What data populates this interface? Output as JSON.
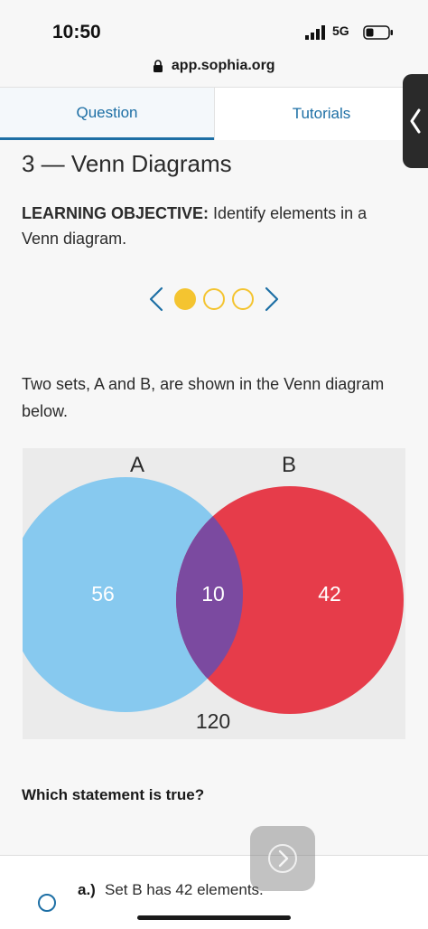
{
  "status_bar": {
    "time": "10:50",
    "network": "5G"
  },
  "browser": {
    "url": "app.sophia.org"
  },
  "tabs": [
    {
      "label": "Question",
      "active": true
    },
    {
      "label": "Tutorials",
      "active": false
    }
  ],
  "page": {
    "title": "3 — Venn Diagrams",
    "objective_label": "LEARNING OBJECTIVE:",
    "objective_text": " Identify elements in a Venn diagram."
  },
  "carousel": {
    "current": 1,
    "total": 3,
    "accent_color": "#f4c430"
  },
  "problem": {
    "prompt": "Two sets, A and B, are shown in the Venn diagram below.",
    "question": "Which statement is true?"
  },
  "venn": {
    "set_a_label": "A",
    "set_b_label": "B",
    "only_a": "56",
    "intersection": "10",
    "only_b": "42",
    "outside": "120",
    "color_a": "#87c9ef",
    "color_b": "#e63c4a",
    "color_overlap": "#7b4aa0"
  },
  "answers": [
    {
      "letter": "a.)",
      "text": "Set B has 42 elements."
    }
  ],
  "colors": {
    "link": "#1d6fa5"
  }
}
